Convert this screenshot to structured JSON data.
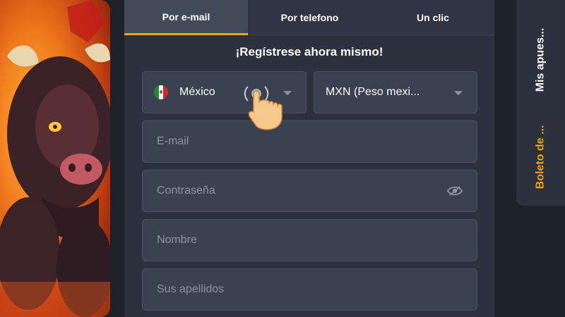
{
  "tabs": [
    {
      "label": "Por e-mail",
      "active": true
    },
    {
      "label": "Por telefono",
      "active": false
    },
    {
      "label": "Un clic",
      "active": false
    }
  ],
  "heading": "¡Regístrese ahora mismo!",
  "country_select": {
    "value": "México",
    "flag": "mexico-flag-icon"
  },
  "currency_select": {
    "value": "MXN (Peso mexi..."
  },
  "fields": {
    "email": {
      "placeholder": "E-mail"
    },
    "password": {
      "placeholder": "Contraseña"
    },
    "first_name": {
      "placeholder": "Nombre"
    },
    "last_name": {
      "placeholder": "Sus apellidos"
    }
  },
  "side_panel": {
    "my_bets": "Mis apues...",
    "bet_slip": "Boleto de ..."
  },
  "colors": {
    "accent": "#f7a600",
    "panel": "#2b313d",
    "field": "#3a4150",
    "background": "#1d2129"
  }
}
